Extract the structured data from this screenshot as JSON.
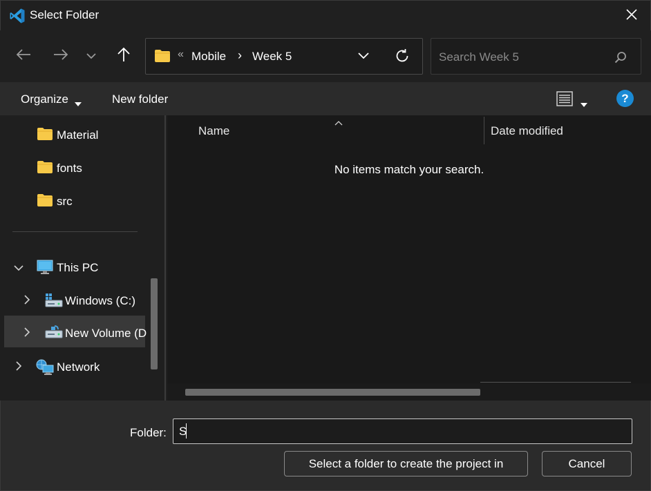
{
  "window": {
    "title": "Select Folder",
    "app_icon": "vscode-icon",
    "close_icon": "close-icon"
  },
  "nav": {
    "back_icon": "back-arrow-icon",
    "forward_icon": "forward-arrow-icon",
    "recent_icon": "chevron-down-icon",
    "up_icon": "up-arrow-icon"
  },
  "address": {
    "overflow": "«",
    "crumbs": [
      "Mobile",
      "Week 5"
    ],
    "separator": "›",
    "refresh_icon": "refresh-icon"
  },
  "search": {
    "placeholder": "Search Week 5"
  },
  "toolbar": {
    "organize": "Organize",
    "new_folder": "New folder",
    "help": "?"
  },
  "sidebar": {
    "items": [
      {
        "label": "Material",
        "icon": "folder-icon"
      },
      {
        "label": "fonts",
        "icon": "folder-icon"
      },
      {
        "label": "src",
        "icon": "folder-icon"
      },
      {
        "label": "This PC",
        "icon": "computer-icon",
        "expanded": true
      },
      {
        "label": "Windows (C:)",
        "icon": "drive-icon"
      },
      {
        "label": "New Volume (D",
        "icon": "drive-icon",
        "selected": true
      },
      {
        "label": "Network",
        "icon": "network-icon"
      }
    ]
  },
  "content": {
    "columns": [
      "Name",
      "Date modified"
    ],
    "empty_message": "No items match your search."
  },
  "footer": {
    "folder_label": "Folder:",
    "folder_value": "S",
    "select_button": "Select a folder to create the project in",
    "cancel_button": "Cancel"
  },
  "colors": {
    "background": "#202020",
    "toolbar": "#2b2b2b",
    "content": "#191919",
    "folder_yellow": "#f7c948",
    "help_blue": "#1a8ad4",
    "vscode_blue": "#2a9de0"
  }
}
